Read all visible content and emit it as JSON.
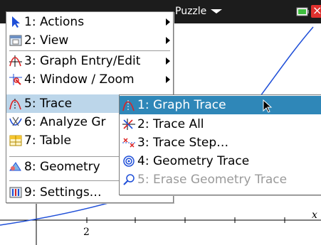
{
  "app": {
    "document_title": "Puzzle",
    "colors": {
      "title_bar": "#1c1c1c",
      "selection": "#2f87b8",
      "hover": "#bcd6ea",
      "curve": "#1f4fd8",
      "disabled_text": "#9a9a9a"
    }
  },
  "graph": {
    "x_tick_label": "2",
    "x_axis_label": "x"
  },
  "main_menu": {
    "items": [
      {
        "label": "1: Actions",
        "icon": "arrow-pointer-icon",
        "has_submenu": true
      },
      {
        "label": "2: View",
        "icon": "view-window-icon",
        "has_submenu": true
      },
      {
        "label": "3: Graph Entry/Edit",
        "icon": "graph-entry-icon",
        "has_submenu": true
      },
      {
        "label": "4: Window / Zoom",
        "icon": "window-zoom-icon",
        "has_submenu": true
      },
      {
        "label": "5: Trace",
        "icon": "trace-icon",
        "has_submenu": true
      },
      {
        "label": "6: Analyze Gr",
        "icon": "analyze-graph-icon",
        "has_submenu": true
      },
      {
        "label": "7: Table",
        "icon": "table-icon",
        "has_submenu": true
      },
      {
        "label": "8: Geometry",
        "icon": "geometry-icon",
        "has_submenu": true
      },
      {
        "label": "9: Settings…",
        "icon": "settings-icon",
        "has_submenu": false
      }
    ]
  },
  "trace_submenu": {
    "items": [
      {
        "label": "1: Graph Trace",
        "icon": "graph-trace-icon",
        "enabled": true
      },
      {
        "label": "2: Trace All",
        "icon": "trace-all-icon",
        "enabled": true
      },
      {
        "label": "3: Trace Step…",
        "icon": "trace-step-icon",
        "enabled": true
      },
      {
        "label": "4: Geometry Trace",
        "icon": "geometry-trace-icon",
        "enabled": true
      },
      {
        "label": "5: Erase Geometry Trace",
        "icon": "erase-geometry-trace-icon",
        "enabled": false
      }
    ]
  }
}
